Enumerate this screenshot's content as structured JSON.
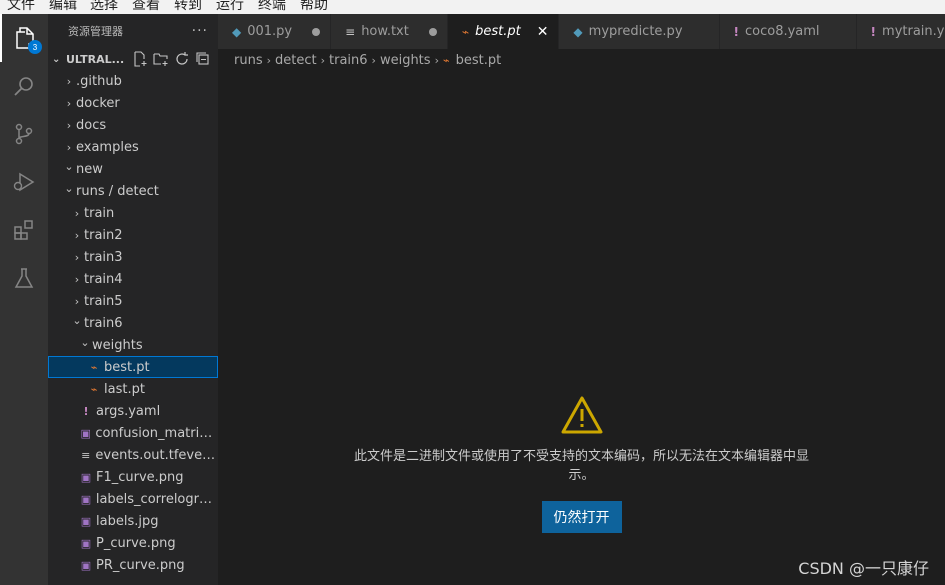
{
  "menubar": [
    "文件",
    "编辑",
    "选择",
    "查看",
    "转到",
    "运行",
    "终端",
    "帮助"
  ],
  "activity": {
    "explorer_badge": "3",
    "icons": [
      "files-icon",
      "search-icon",
      "source-control-icon",
      "run-debug-icon",
      "extensions-icon",
      "testing-icon"
    ]
  },
  "sidebar": {
    "title": "资源管理器",
    "more": "···",
    "root": "ULTRAL...",
    "tree": [
      {
        "label": ".github",
        "kind": "folder",
        "state": "closed",
        "depth": 0
      },
      {
        "label": "docker",
        "kind": "folder",
        "state": "closed",
        "depth": 0
      },
      {
        "label": "docs",
        "kind": "folder",
        "state": "closed",
        "depth": 0
      },
      {
        "label": "examples",
        "kind": "folder",
        "state": "closed",
        "depth": 0
      },
      {
        "label": "new",
        "kind": "folder",
        "state": "open",
        "depth": 0
      },
      {
        "label": "runs / detect",
        "kind": "folder",
        "state": "open",
        "depth": 0
      },
      {
        "label": "train",
        "kind": "folder",
        "state": "closed",
        "depth": 1
      },
      {
        "label": "train2",
        "kind": "folder",
        "state": "closed",
        "depth": 1
      },
      {
        "label": "train3",
        "kind": "folder",
        "state": "closed",
        "depth": 1
      },
      {
        "label": "train4",
        "kind": "folder",
        "state": "closed",
        "depth": 1
      },
      {
        "label": "train5",
        "kind": "folder",
        "state": "closed",
        "depth": 1
      },
      {
        "label": "train6",
        "kind": "folder",
        "state": "open",
        "depth": 1
      },
      {
        "label": "weights",
        "kind": "folder",
        "state": "open",
        "depth": 2
      },
      {
        "label": "best.pt",
        "kind": "rss",
        "depth": 3,
        "selected": true
      },
      {
        "label": "last.pt",
        "kind": "rss",
        "depth": 3
      },
      {
        "label": "args.yaml",
        "kind": "yaml",
        "depth": 2
      },
      {
        "label": "confusion_matrix....",
        "kind": "img",
        "depth": 2
      },
      {
        "label": "events.out.tfeven...",
        "kind": "txt",
        "depth": 2
      },
      {
        "label": "F1_curve.png",
        "kind": "img",
        "depth": 2
      },
      {
        "label": "labels_correlogra...",
        "kind": "img",
        "depth": 2
      },
      {
        "label": "labels.jpg",
        "kind": "img",
        "depth": 2
      },
      {
        "label": "P_curve.png",
        "kind": "img",
        "depth": 2
      },
      {
        "label": "PR_curve.png",
        "kind": "img",
        "depth": 2
      }
    ]
  },
  "tabs": [
    {
      "label": "001.py",
      "kind": "py",
      "dirty": true
    },
    {
      "label": "how.txt",
      "kind": "txt",
      "dirty": true
    },
    {
      "label": "best.pt",
      "kind": "rss",
      "active": true,
      "italic": true,
      "close": "✕"
    },
    {
      "label": "mypredicte.py",
      "kind": "py"
    },
    {
      "label": "coco8.yaml",
      "kind": "yaml"
    },
    {
      "label": "mytrain.ya",
      "kind": "yaml"
    }
  ],
  "breadcrumb": [
    "runs",
    "detect",
    "train6",
    "weights",
    "best.pt"
  ],
  "editor": {
    "message": "此文件是二进制文件或使用了不受支持的文本编码，所以无法在文本编辑器中显示。",
    "open_button": "仍然打开"
  },
  "watermark": "CSDN @一只康仔",
  "colors": {
    "accent": "#0078d4",
    "button": "#0e639c",
    "warning": "#cca700"
  }
}
